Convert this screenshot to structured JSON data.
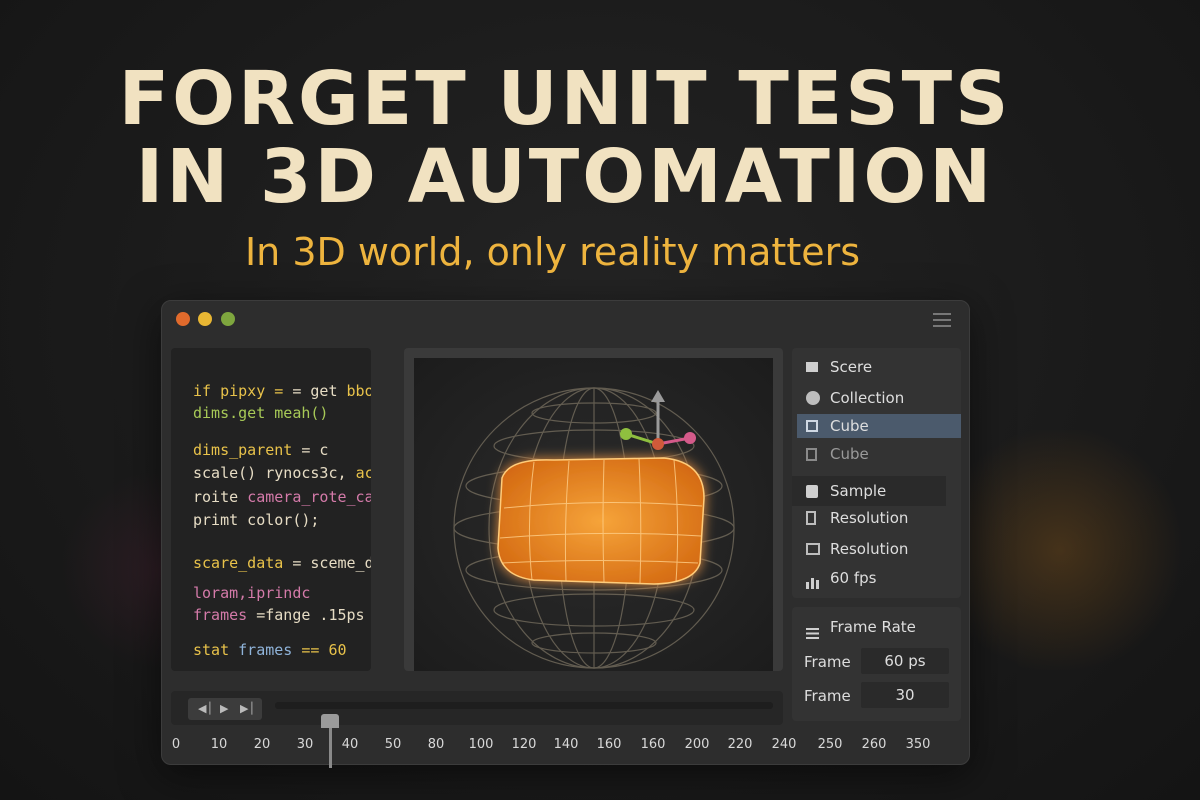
{
  "headline": {
    "line1": "FORGET UNIT TESTS",
    "line2": "IN 3D AUTOMATION",
    "subtitle": "In 3D world, only reality matters"
  },
  "window": {
    "controls": [
      "close",
      "minimize",
      "maximize"
    ],
    "control_colors": {
      "close": "#e06a2c",
      "minimize": "#e8b633",
      "maximize": "#7ea63e"
    },
    "menu_icon": "hamburger-icon"
  },
  "code": {
    "l1a": "if pipxy = ",
    "l1b": "= get ",
    "l1c": "bboxcd",
    "l2a": "dims",
    "l2b": ".get meah()",
    "l3a": "dims_parent",
    "l3b": " = c",
    "l4a": "scale()",
    "l4b": " rynocs3c, ",
    "l4c": "acl",
    "l5a": "roite ",
    "l5b": "camera_rote_car",
    "l6a": "primt",
    "l6b": " color();",
    "l7a": "scare_data",
    "l7b": " = sceme_data",
    "l8": "loram,iprindc",
    "l9a": "frames",
    "l9b": " =fange .15ps",
    "l10a": "stat",
    "l10b": " frames",
    "l10c": " == 60"
  },
  "scene": {
    "header": "Scere",
    "items": [
      {
        "label": "Collection",
        "icon": "circle-icon"
      },
      {
        "label": "Cube",
        "icon": "cube-icon",
        "selected": true
      },
      {
        "label": "Cube",
        "icon": "mesh-icon"
      },
      {
        "label": "Sample",
        "icon": "person-icon"
      },
      {
        "label": "Resolution",
        "icon": "phone-icon"
      },
      {
        "label": "Resolution",
        "icon": "monitor-icon"
      },
      {
        "label": "60 fps",
        "icon": "bar-chart-icon"
      }
    ]
  },
  "properties": {
    "header": "Frame Rate",
    "rows": [
      {
        "label": "Frame",
        "value": "60 ps"
      },
      {
        "label": "Frame",
        "value": "30"
      }
    ]
  },
  "timeline": {
    "ticks": [
      "0",
      "10",
      "20",
      "30",
      "40",
      "50",
      "80",
      "100",
      "120",
      "140",
      "160",
      "160",
      "200",
      "220",
      "240",
      "250",
      "260",
      "350"
    ]
  },
  "colors": {
    "headline": "#f1e2c1",
    "subtitle": "#eeb43e",
    "accent_orange": "#f09a2a",
    "selection": "#4b5a6c"
  }
}
